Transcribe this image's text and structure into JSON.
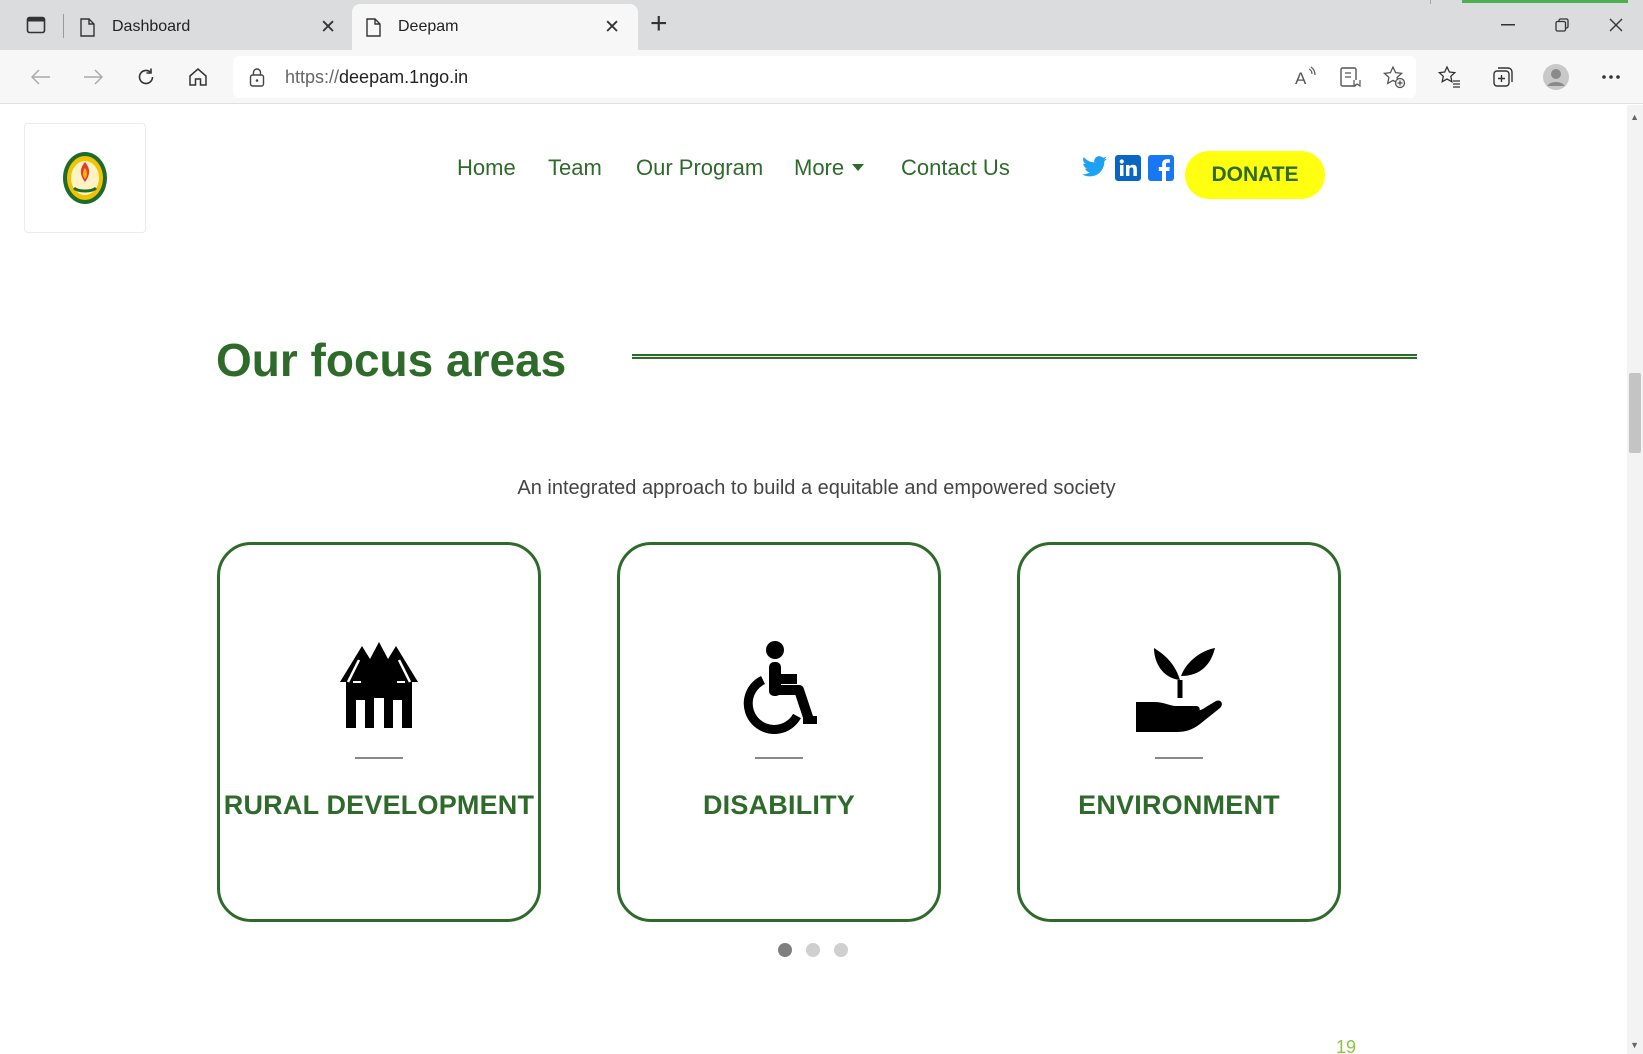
{
  "browser": {
    "tabs": [
      {
        "title": "Dashboard",
        "active": false
      },
      {
        "title": "Deepam",
        "active": true
      }
    ],
    "url_protocol": "https://",
    "url_host": "deepam.1ngo.in",
    "toolbar_icons": [
      "read-aloud-icon",
      "immersive-reader-icon",
      "add-favorite-icon",
      "favorites-icon",
      "collections-icon",
      "profile-icon",
      "more-icon"
    ],
    "window_controls": [
      "minimize",
      "restore",
      "close"
    ]
  },
  "site": {
    "nav": {
      "home": "Home",
      "team": "Team",
      "program": "Our Program",
      "more": "More",
      "contact": "Contact Us"
    },
    "social": [
      "twitter",
      "linkedin",
      "facebook"
    ],
    "donate_label": "DONATE",
    "colors": {
      "brand_green": "#2e6b2b",
      "donate_yellow": "#ffff0f"
    }
  },
  "focus": {
    "title": "Our focus areas",
    "subtitle": "An integrated approach to build a equitable and empowered society",
    "cards": [
      {
        "label": "RURAL DEVELOPMENT",
        "icon": "houses-icon"
      },
      {
        "label": "DISABILITY",
        "icon": "wheelchair-icon"
      },
      {
        "label": "ENVIRONMENT",
        "icon": "plant-in-hand-icon"
      }
    ],
    "carousel_pages": 3,
    "carousel_active": 1
  },
  "page_number": "19"
}
